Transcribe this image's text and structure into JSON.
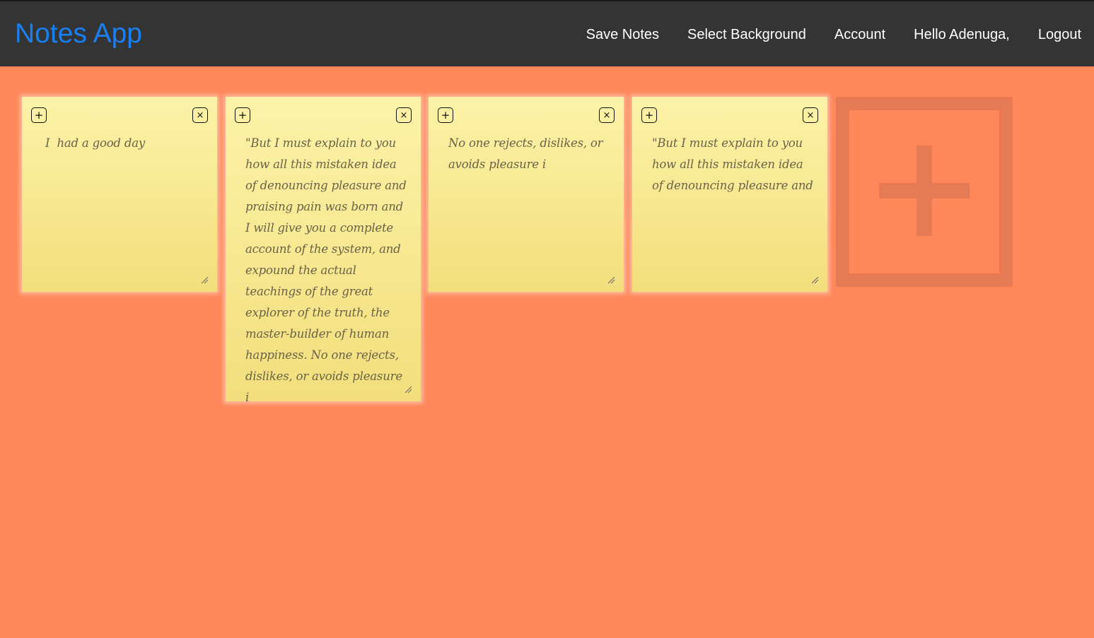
{
  "header": {
    "brand": "Notes App",
    "nav": [
      {
        "label": "Save Notes"
      },
      {
        "label": "Select Background"
      },
      {
        "label": "Account"
      },
      {
        "label": "Hello Adenuga,"
      },
      {
        "label": "Logout"
      }
    ]
  },
  "notes": [
    {
      "text": " I  had a good day",
      "add_icon": "+",
      "delete_icon": "×"
    },
    {
      "text": "\"But I must explain to you how all this mistaken idea of denouncing pleasure and praising pain was born and I will give you a complete account of the system, and expound the actual teachings of the great explorer of the truth, the master-builder of human happiness. No one rejects, dislikes, or avoids pleasure i",
      "add_icon": "+",
      "delete_icon": "×"
    },
    {
      "text": "No one rejects, dislikes, or avoids pleasure i",
      "add_icon": "+",
      "delete_icon": "×"
    },
    {
      "text": "\"But I must explain to you how all this mistaken idea of denouncing pleasure and",
      "add_icon": "+",
      "delete_icon": "×"
    }
  ],
  "add_note_tile": {
    "icon": "plus-icon"
  },
  "colors": {
    "background": "#ff875a",
    "header": "#343434",
    "brand": "#1a7ff0",
    "note_top": "#fdf2a8",
    "note_bottom": "#f2de7c",
    "add_tile": "#e57a55"
  }
}
